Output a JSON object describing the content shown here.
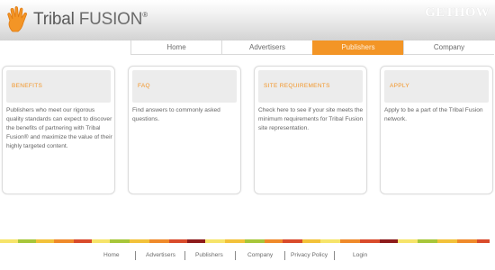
{
  "header": {
    "brand_word1": "Tribal",
    "brand_word2": "FUSION",
    "brand_mark": "®",
    "right_wordmark": "GETHOW",
    "logo_icon": "orange-hand-logo-icon"
  },
  "nav": {
    "items": [
      {
        "label": "Home"
      },
      {
        "label": "Advertisers"
      },
      {
        "label": "Publishers",
        "active": true
      },
      {
        "label": "Company"
      }
    ]
  },
  "cards": [
    {
      "title": "BENEFITS",
      "text": "Publishers who meet our rigorous quality standards can expect to discover the benefits of partnering with Tribal Fusion® and maximize the value of their highly targeted content."
    },
    {
      "title": "FAQ",
      "text": "Find answers to commonly asked questions."
    },
    {
      "title": "SITE REQUIREMENTS",
      "text": "Check here to see if your site meets the minimum requirements for Tribal Fusion site representation."
    },
    {
      "title": "APPLY",
      "text": "Apply to be a part of the Tribal Fusion network."
    }
  ],
  "footer": {
    "links": [
      "Home",
      "Advertisers",
      "Publishers",
      "Company",
      "Privacy Policy",
      "Login"
    ]
  },
  "colors": {
    "accent": "#f39526",
    "text_gray": "#666666",
    "stripe": [
      "#a7c63a",
      "#f2c23a",
      "#ef8a2a",
      "#d94b2b",
      "#8d1b1b",
      "#f6e46a"
    ]
  }
}
